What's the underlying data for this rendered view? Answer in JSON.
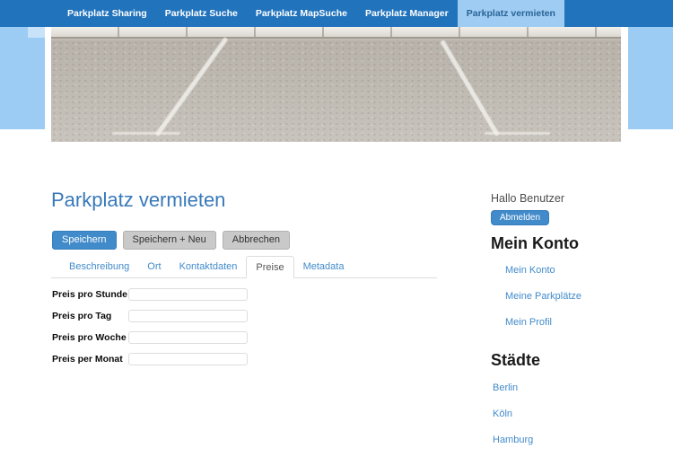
{
  "nav": {
    "items": [
      {
        "label": "Parkplatz Sharing",
        "active": false
      },
      {
        "label": "Parkplatz Suche",
        "active": false
      },
      {
        "label": "Parkplatz MapSuche",
        "active": false
      },
      {
        "label": "Parkplatz Manager",
        "active": false
      },
      {
        "label": "Parkplatz vermieten",
        "active": true
      }
    ]
  },
  "hero": {
    "description": "photo of empty parking spaces on grey asphalt with white diagonal marking lines and a concrete curb"
  },
  "main": {
    "title": "Parkplatz vermieten",
    "toolbar": {
      "save_label": "Speichern",
      "save_new_label": "Speichern + Neu",
      "cancel_label": "Abbrechen"
    },
    "tabs": [
      {
        "label": "Beschreibung",
        "active": false
      },
      {
        "label": "Ort",
        "active": false
      },
      {
        "label": "Kontaktdaten",
        "active": false
      },
      {
        "label": "Preise",
        "active": true
      },
      {
        "label": "Metadata",
        "active": false
      }
    ],
    "form": {
      "fields": [
        {
          "label": "Preis pro Stunde",
          "value": ""
        },
        {
          "label": "Preis pro Tag",
          "value": ""
        },
        {
          "label": "Preis pro Woche",
          "value": ""
        },
        {
          "label": "Preis per Monat",
          "value": ""
        }
      ]
    }
  },
  "sidebar": {
    "greeting": "Hallo Benutzer",
    "logout_label": "Abmelden",
    "account_heading": "Mein Konto",
    "account_links": [
      "Mein Konto",
      "Meine Parkplätze",
      "Mein Profil"
    ],
    "cities_heading": "Städte",
    "city_links": [
      "Berlin",
      "Köln",
      "Hamburg"
    ]
  },
  "colors": {
    "navbar_bg": "#2173bc",
    "nav_active_bg": "#9fccf3",
    "nav_active_text": "#2a6496",
    "accent_blue": "#428bca",
    "title_blue": "#3879b9",
    "deco_panel_blue": "#9ccbf4",
    "gray_button_bg": "#c9c9c9"
  }
}
